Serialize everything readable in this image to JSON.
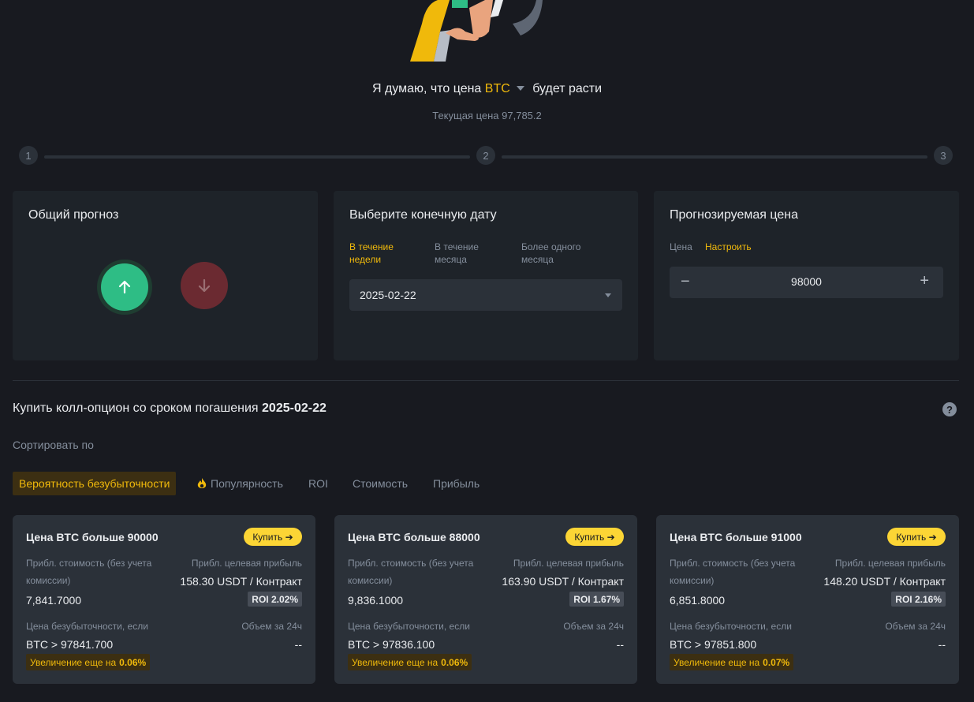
{
  "hero": {
    "prefix": "Я думаю, что цена",
    "asset": "BTC",
    "suffix": "будет расти",
    "current_price_text": "Текущая цена 97,785.2"
  },
  "steps": [
    "1",
    "2",
    "3"
  ],
  "panels": {
    "forecast": {
      "title": "Общий прогноз",
      "up_icon": "arrow-up-icon",
      "down_icon": "arrow-down-icon"
    },
    "date": {
      "title": "Выберите конечную дату",
      "tabs": [
        "В течение недели",
        "В течение месяца",
        "Более одного месяца"
      ],
      "active_tab": 0,
      "selected_date": "2025-02-22"
    },
    "price": {
      "title": "Прогнозируемая цена",
      "label": "Цена",
      "customize": "Настроить",
      "minus": "−",
      "plus": "+",
      "value": "98000"
    }
  },
  "section": {
    "title_prefix": "Купить колл-опцион со сроком погашения",
    "title_date": "2025-02-22",
    "help": "?"
  },
  "sort": {
    "label": "Сортировать по",
    "tabs": [
      "Вероятность безубыточности",
      "Популярность",
      "ROI",
      "Стоимость",
      "Прибыль"
    ],
    "active": 0
  },
  "cards": [
    {
      "title": "Цена BTC больше 90000",
      "buy": "Купить",
      "cost_label": "Прибл. стоимость (без учета комиссии)",
      "cost": "7,841.7000",
      "profit_label": "Прибл. целевая прибыль",
      "profit": "158.30 USDT / Контракт",
      "roi": "ROI 2.02%",
      "breakeven_label": "Цена безубыточности, если",
      "breakeven": "BTC > 97841.700",
      "volume_label": "Объем за 24ч",
      "volume": "--",
      "increase_label": "Увеличение еще на",
      "increase": "0.06%"
    },
    {
      "title": "Цена BTC больше 88000",
      "buy": "Купить",
      "cost_label": "Прибл. стоимость (без учета комиссии)",
      "cost": "9,836.1000",
      "profit_label": "Прибл. целевая прибыль",
      "profit": "163.90 USDT / Контракт",
      "roi": "ROI 1.67%",
      "breakeven_label": "Цена безубыточности, если",
      "breakeven": "BTC > 97836.100",
      "volume_label": "Объем за 24ч",
      "volume": "--",
      "increase_label": "Увеличение еще на",
      "increase": "0.06%"
    },
    {
      "title": "Цена BTC больше 91000",
      "buy": "Купить",
      "cost_label": "Прибл. стоимость (без учета комиссии)",
      "cost": "6,851.8000",
      "profit_label": "Прибл. целевая прибыль",
      "profit": "148.20 USDT / Контракт",
      "roi": "ROI 2.16%",
      "breakeven_label": "Цена безубыточности, если",
      "breakeven": "BTC > 97851.800",
      "volume_label": "Объем за 24ч",
      "volume": "--",
      "increase_label": "Увеличение еще на",
      "increase": "0.07%"
    }
  ],
  "colors": {
    "accent": "#f0b90b",
    "up": "#2ebd85",
    "down": "#6b2a31",
    "bg": "#181a20",
    "panel": "#1e2329"
  }
}
